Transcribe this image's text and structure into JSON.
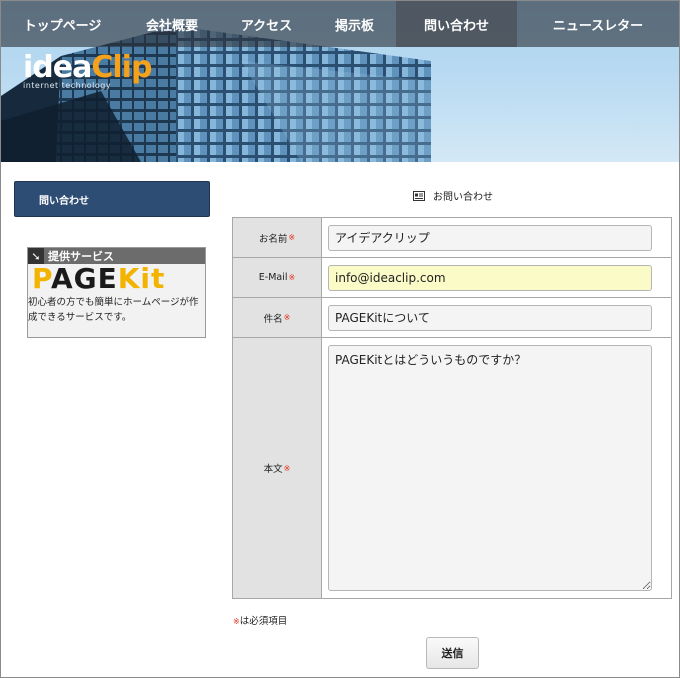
{
  "nav": {
    "items": [
      {
        "label": "トップページ",
        "active": false
      },
      {
        "label": "会社概要",
        "active": false
      },
      {
        "label": "アクセス",
        "active": false
      },
      {
        "label": "掲示板",
        "active": false
      },
      {
        "label": "問い合わせ",
        "active": true
      },
      {
        "label": "ニュースレター",
        "active": false
      }
    ]
  },
  "logo": {
    "part1": "idea",
    "part2": "Clip",
    "subtitle": "internet technology"
  },
  "sidebar": {
    "button_label": "問い合わせ",
    "banner": {
      "heading": "提供サービス",
      "logo_part1": "P",
      "logo_part2": "AGE",
      "logo_part3": "Kit",
      "description": "初心者の方でも簡単にホームページが作成できるサービスです。"
    }
  },
  "content": {
    "page_title": "お問い合わせ",
    "form": {
      "required_mark": "※",
      "name": {
        "label": "お名前",
        "value": "アイデアクリップ"
      },
      "email": {
        "label": "E-Mail",
        "value": "info@ideaclip.com"
      },
      "subject": {
        "label": "件名",
        "value": "PAGEKitについて"
      },
      "body": {
        "label": "本文",
        "value": "PAGEKitとはどういうものですか？"
      }
    },
    "required_note_text": "は必須項目",
    "submit_label": "送信"
  },
  "colors": {
    "nav_bg": "#2d323a",
    "sidebar_button": "#2e4d74",
    "logo_accent": "#f4a21c",
    "required_mark": "#e0301e",
    "email_highlight": "#fbfbc8"
  },
  "icons": {
    "page_title": "form-icon",
    "banner": "arrow-icon"
  }
}
